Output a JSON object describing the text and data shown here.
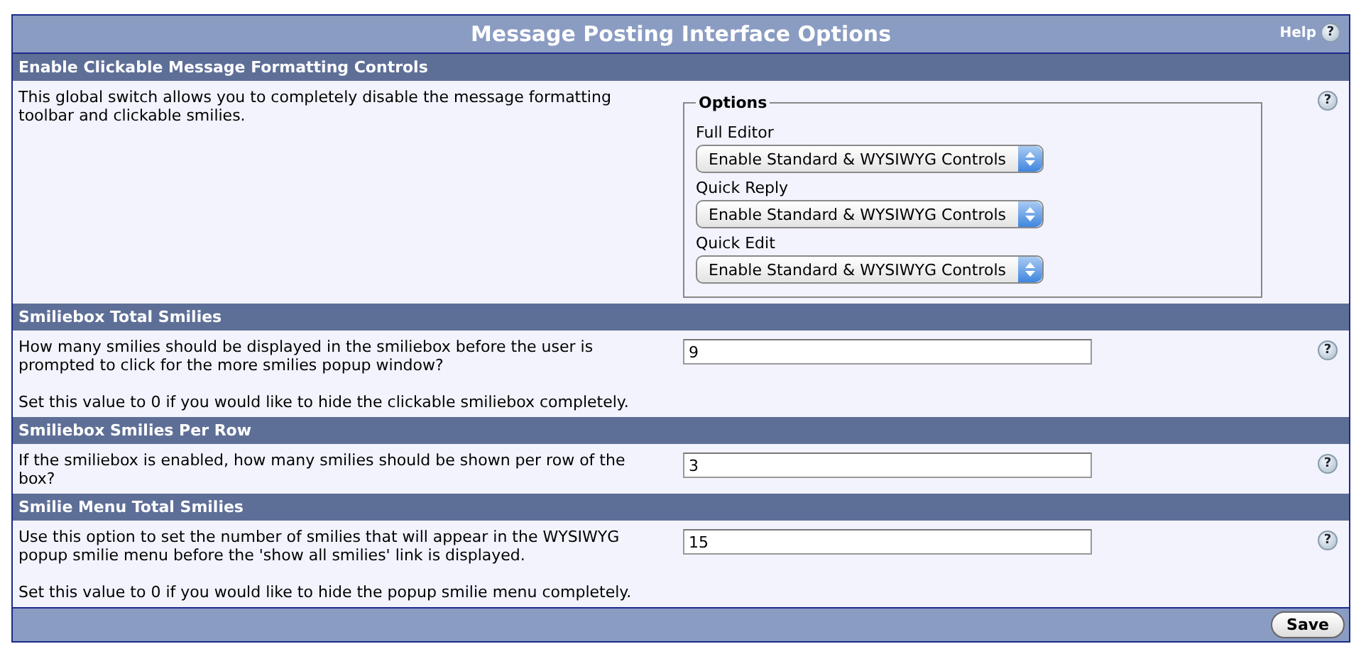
{
  "panel": {
    "title": "Message Posting Interface Options",
    "help_label": "Help",
    "help_glyph": "?"
  },
  "sections": [
    {
      "kind": "selects",
      "heading": "Enable Clickable Message Formatting Controls",
      "description": [
        "This global switch allows you to completely disable the message formatting toolbar and clickable smilies."
      ],
      "help_glyph": "?",
      "fieldset": {
        "legend": "Options",
        "selects": [
          {
            "label": "Full Editor",
            "value": "Enable Standard & WYSIWYG Controls"
          },
          {
            "label": "Quick Reply",
            "value": "Enable Standard & WYSIWYG Controls"
          },
          {
            "label": "Quick Edit",
            "value": "Enable Standard & WYSIWYG Controls"
          }
        ]
      }
    },
    {
      "kind": "text",
      "heading": "Smiliebox Total Smilies",
      "description": [
        "How many smilies should be displayed in the smiliebox before the user is prompted to click for the more smilies popup window?",
        "Set this value to 0 if you would like to hide the clickable smiliebox completely."
      ],
      "help_glyph": "?",
      "value": "9"
    },
    {
      "kind": "text",
      "heading": "Smiliebox Smilies Per Row",
      "description": [
        "If the smiliebox is enabled, how many smilies should be shown per row of the box?"
      ],
      "help_glyph": "?",
      "value": "3"
    },
    {
      "kind": "text",
      "heading": "Smilie Menu Total Smilies",
      "description": [
        "Use this option to set the number of smilies that will appear in the WYSIWYG popup smilie menu before the 'show all smilies' link is displayed.",
        "Set this value to 0 if you would like to hide the popup smilie menu completely."
      ],
      "help_glyph": "?",
      "value": "15"
    }
  ],
  "footer": {
    "button": "Save"
  }
}
